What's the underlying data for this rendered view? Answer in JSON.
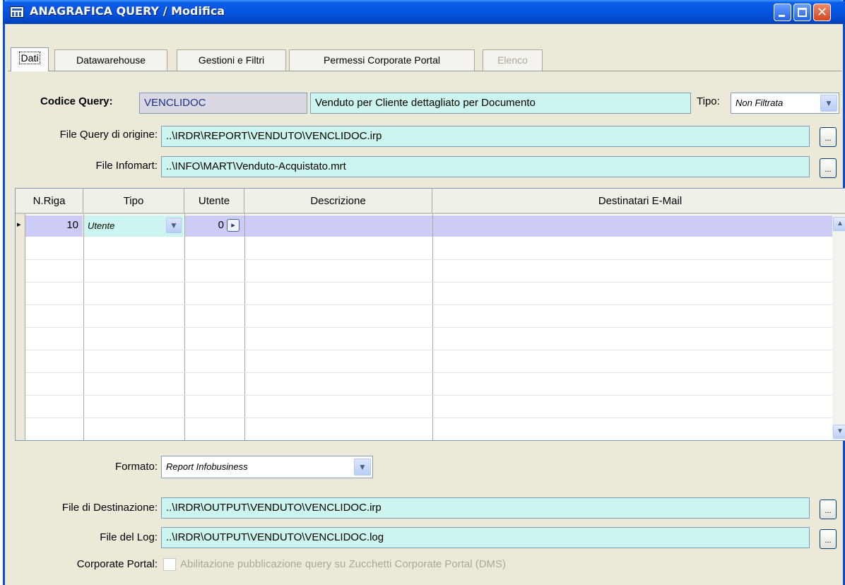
{
  "window": {
    "title": "ANAGRAFICA QUERY / Modifica",
    "close_glyph": "✕"
  },
  "tabs": [
    {
      "label": "Dati"
    },
    {
      "label": "Datawarehouse"
    },
    {
      "label": "Gestioni e Filtri"
    },
    {
      "label": "Permessi Corporate Portal"
    },
    {
      "label": "Elenco"
    }
  ],
  "form": {
    "codice_label": "Codice Query:",
    "codice_value": "VENCLIDOC",
    "descrizione_value": "Venduto per Cliente dettagliato per Documento",
    "tipo_label": "Tipo:",
    "tipo_value": "Non Filtrata",
    "file_query_label": "File Query di origine:",
    "file_query_value": "..\\IRDR\\REPORT\\VENDUTO\\VENCLIDOC.irp",
    "file_infomart_label": "File Infomart:",
    "file_infomart_value": "..\\INFO\\MART\\Venduto-Acquistato.mrt",
    "ellipsis": "..."
  },
  "grid": {
    "columns": [
      "N.Riga",
      "Tipo",
      "Utente",
      "Descrizione",
      "Destinatari E-Mail"
    ],
    "rows": [
      {
        "n_riga": "10",
        "tipo": "Utente",
        "utente": "0",
        "descrizione": "",
        "destinatari": ""
      }
    ],
    "row_marker": "▸",
    "scroll_up": "▲",
    "scroll_down": "▼"
  },
  "bottom": {
    "formato_label": "Formato:",
    "formato_value": "Report Infobusiness",
    "file_dest_label": "File di Destinazione:",
    "file_dest_value": "..\\IRDR\\OUTPUT\\VENDUTO\\VENCLIDOC.irp",
    "file_log_label": "File del Log:",
    "file_log_value": "..\\IRDR\\OUTPUT\\VENDUTO\\VENCLIDOC.log",
    "portal_label": "Corporate Portal:",
    "portal_checkbox_label": "Abilitazione pubblicazione query su Zucchetti Corporate Portal (DMS)"
  },
  "icons": {
    "dropdown": "chevron-down-icon",
    "lookup": "arrow-right-icon"
  }
}
